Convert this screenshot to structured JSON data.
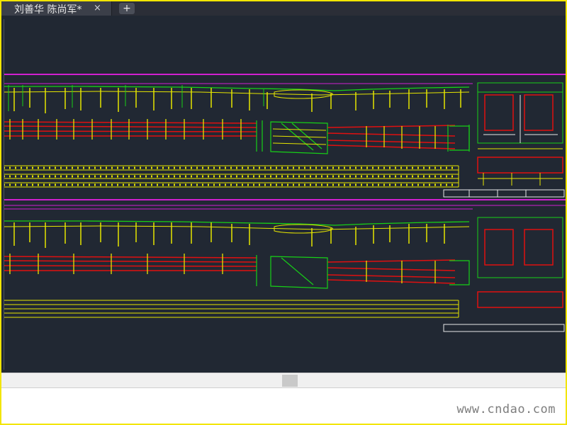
{
  "app": {
    "tab_title": "刘善华 陈尚军*",
    "tab_close_symbol": "×",
    "new_tab_symbol": "+"
  },
  "footer": {
    "watermark": "www.cndao.com"
  },
  "colors": {
    "canvas_bg": "#212833",
    "frame_border": "#f2e500",
    "magenta": "#d020d0",
    "yellow": "#e6e600",
    "green": "#17d017",
    "red": "#e01010",
    "white": "#e8e8e8",
    "cyan": "#2ad0ff"
  },
  "icons": {
    "tab_close": "close-icon",
    "new_tab": "plus-icon"
  }
}
